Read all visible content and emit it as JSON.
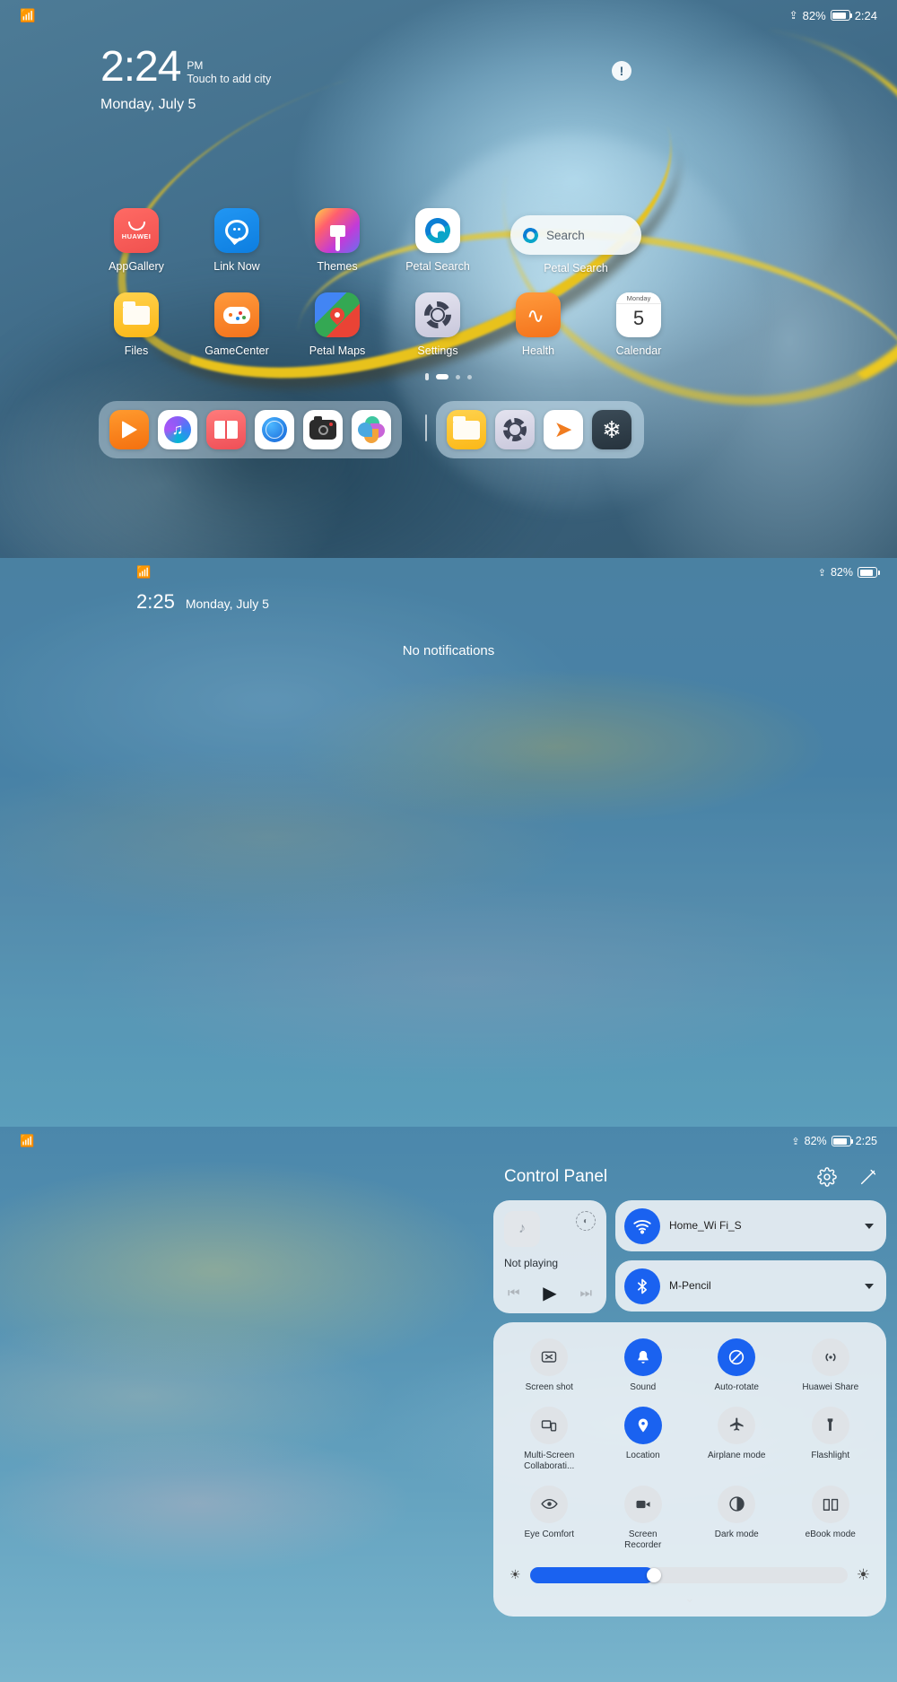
{
  "home": {
    "status": {
      "wifi_icon": "wifi-icon",
      "bluetooth_icon": "bluetooth-icon",
      "battery_pct": "82%",
      "time": "2:24"
    },
    "clock": {
      "time": "2:24",
      "ampm": "PM",
      "city_hint": "Touch to add city",
      "date": "Monday, July 5"
    },
    "alert_badge": "!",
    "row1": [
      {
        "label": "AppGallery",
        "icon": "appgallery-icon",
        "brand": "HUAWEI"
      },
      {
        "label": "Link Now",
        "icon": "linknow-icon"
      },
      {
        "label": "Themes",
        "icon": "themes-icon"
      },
      {
        "label": "Petal Search",
        "icon": "petalsearch-icon"
      }
    ],
    "row2": [
      {
        "label": "Files",
        "icon": "files-icon"
      },
      {
        "label": "GameCenter",
        "icon": "gamecenter-icon"
      },
      {
        "label": "Petal Maps",
        "icon": "petalmaps-icon"
      },
      {
        "label": "Settings",
        "icon": "settings-icon"
      },
      {
        "label": "Health",
        "icon": "health-icon"
      },
      {
        "label": "Calendar",
        "icon": "calendar-icon",
        "cal_weekday": "Monday",
        "cal_day": "5"
      }
    ],
    "search_widget": {
      "placeholder": "Search",
      "label": "Petal Search",
      "icon": "petalsearch-icon"
    },
    "dock_left": [
      {
        "name": "video-icon"
      },
      {
        "name": "music-icon"
      },
      {
        "name": "books-icon"
      },
      {
        "name": "browser-icon"
      },
      {
        "name": "camera-icon"
      },
      {
        "name": "gallery-icon"
      }
    ],
    "dock_right": [
      {
        "name": "files-icon"
      },
      {
        "name": "settings-icon"
      },
      {
        "name": "himovie-icon"
      },
      {
        "name": "snowflake-icon"
      }
    ],
    "pages": {
      "count": 3,
      "active": 0
    }
  },
  "shade": {
    "status": {
      "battery_pct": "82%"
    },
    "time": "2:25",
    "date": "Monday, July 5",
    "empty_text": "No notifications"
  },
  "control_panel": {
    "status": {
      "battery_pct": "82%",
      "time": "2:25"
    },
    "title": "Control Panel",
    "header_icons": [
      {
        "name": "gear-icon"
      },
      {
        "name": "edit-pencil-icon"
      }
    ],
    "media": {
      "title": "Not playing",
      "art_icon": "music-note-icon",
      "cast_icon": "cast-audio-icon",
      "prev_icon": "previous-track-icon",
      "play_icon": "play-icon",
      "next_icon": "next-track-icon"
    },
    "wifi": {
      "label": "Home_Wi Fi_S",
      "icon": "wifi-icon",
      "active": true
    },
    "bluetooth": {
      "label": "M-Pencil",
      "icon": "bluetooth-icon",
      "active": true
    },
    "toggles": [
      {
        "label": "Screen shot",
        "icon": "screenshot-icon",
        "on": false,
        "caret": true
      },
      {
        "label": "Sound",
        "icon": "bell-icon",
        "on": true
      },
      {
        "label": "Auto-rotate",
        "icon": "rotate-lock-icon",
        "on": true
      },
      {
        "label": "Huawei Share",
        "icon": "huawei-share-icon",
        "on": false
      },
      {
        "label": "Multi-Screen Collaborati...",
        "icon": "multiscreen-icon",
        "on": false
      },
      {
        "label": "Location",
        "icon": "location-pin-icon",
        "on": true
      },
      {
        "label": "Airplane mode",
        "icon": "airplane-icon",
        "on": false
      },
      {
        "label": "Flashlight",
        "icon": "flashlight-icon",
        "on": false
      },
      {
        "label": "Eye Comfort",
        "icon": "eye-icon",
        "on": false
      },
      {
        "label": "Screen Recorder",
        "icon": "screen-recorder-icon",
        "on": false
      },
      {
        "label": "Dark mode",
        "icon": "dark-mode-icon",
        "on": false
      },
      {
        "label": "eBook mode",
        "icon": "ebook-icon",
        "on": false
      }
    ],
    "brightness": {
      "value": 39,
      "low_icon": "brightness-low-icon",
      "high_icon": "brightness-high-icon"
    },
    "collapse_handle": "chevron-down-icon",
    "accent_color": "#1a62f0"
  }
}
